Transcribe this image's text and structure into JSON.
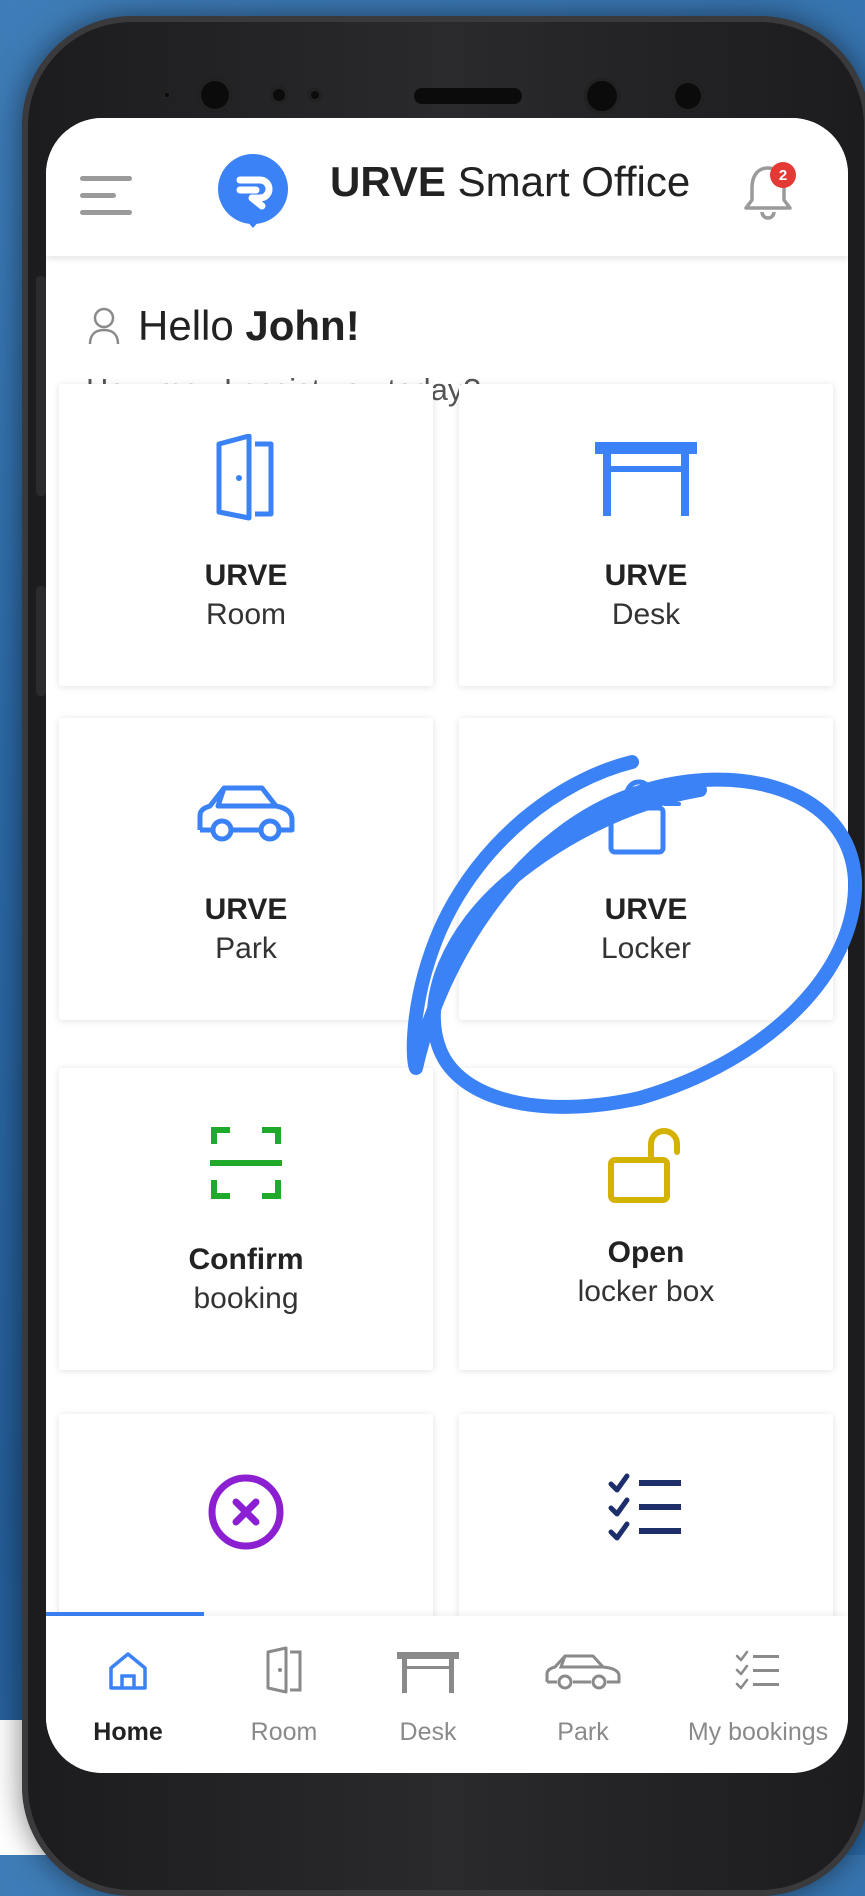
{
  "app": {
    "brand_bold": "URVE",
    "brand_light": " Smart Office",
    "notification_count": "2"
  },
  "greeting": {
    "hello": "Hello ",
    "name": "John!",
    "subtitle": "How may I assist you today?"
  },
  "cards": [
    {
      "line1": "URVE",
      "line2": "Room",
      "icon": "door-icon"
    },
    {
      "line1": "URVE",
      "line2": "Desk",
      "icon": "desk-icon"
    },
    {
      "line1": "URVE",
      "line2": "Park",
      "icon": "car-icon"
    },
    {
      "line1": "URVE",
      "line2": "Locker",
      "icon": "unlocked-padlock-icon"
    },
    {
      "line1": "Confirm",
      "line2": "booking",
      "icon": "scan-icon"
    },
    {
      "line1": "Open",
      "line2": "locker box",
      "icon": "open-padlock-icon"
    },
    {
      "icon": "cancel-circle-icon"
    },
    {
      "icon": "checklist-icon"
    }
  ],
  "nav": [
    {
      "label": "Home",
      "icon": "home-icon",
      "active": true
    },
    {
      "label": "Room",
      "icon": "door-icon"
    },
    {
      "label": "Desk",
      "icon": "desk-icon"
    },
    {
      "label": "Park",
      "icon": "car-icon"
    },
    {
      "label": "My bookings",
      "icon": "checklist-icon"
    }
  ],
  "colors": {
    "accent_blue": "#3b82f6",
    "confirm_green": "#1faa2b",
    "open_yellow": "#d4b200",
    "cancel_purple": "#8b1fd1",
    "checklist_navy": "#1c2f6b",
    "badge_red": "#e53935",
    "background_blue": "#2c69a6"
  }
}
